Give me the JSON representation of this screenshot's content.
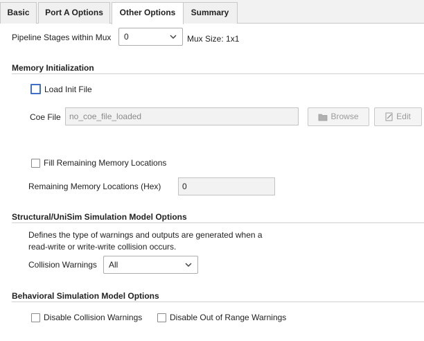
{
  "tabs": [
    {
      "label": "Basic"
    },
    {
      "label": "Port A Options"
    },
    {
      "label": "Other Options"
    },
    {
      "label": "Summary"
    }
  ],
  "pipeline": {
    "label": "Pipeline Stages within Mux",
    "value": "0",
    "mux_size": "Mux Size: 1x1"
  },
  "memory_init": {
    "title": "Memory Initialization",
    "load_init_label": "Load Init File",
    "load_init_checked": false,
    "coe_label": "Coe File",
    "coe_value": "no_coe_file_loaded",
    "browse_label": "Browse",
    "edit_label": "Edit",
    "fill_remaining_label": "Fill Remaining Memory Locations",
    "fill_remaining_checked": false,
    "remaining_label": "Remaining Memory Locations (Hex)",
    "remaining_value": "0"
  },
  "structural": {
    "title": "Structural/UniSim Simulation Model Options",
    "desc_line1": "Defines the type of warnings and outputs are generated when a",
    "desc_line2": "read-write or write-write collision occurs.",
    "collision_label": "Collision Warnings",
    "collision_value": "All"
  },
  "behavioral": {
    "title": "Behavioral Simulation Model Options",
    "disable_collision_label": "Disable Collision Warnings",
    "disable_collision_checked": false,
    "disable_range_label": "Disable Out of Range Warnings",
    "disable_range_checked": false
  },
  "colors": {
    "focus_border": "#3f6fc9",
    "separator": "#cfcfcf"
  }
}
